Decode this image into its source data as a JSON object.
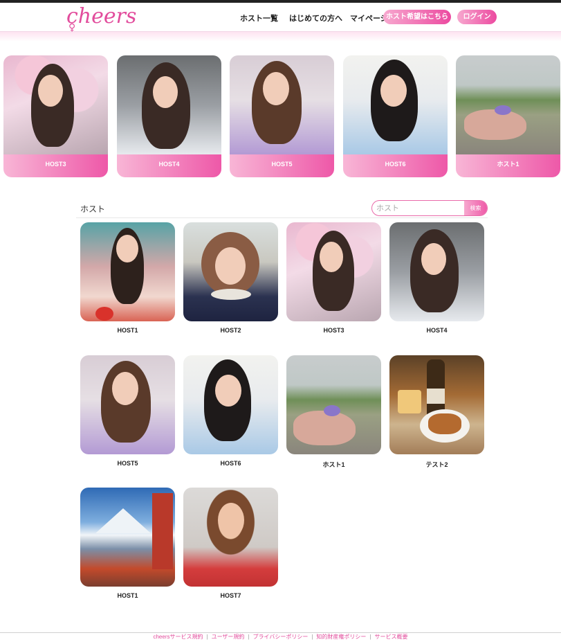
{
  "header": {
    "logo": "cheers",
    "nav": [
      "ホスト一覧",
      "はじめての方へ",
      "マイページ"
    ],
    "host_apply": "ホスト希望はこちら",
    "login": "ログイン"
  },
  "featured": [
    {
      "name": "HOST3",
      "photo": "cherry"
    },
    {
      "name": "HOST4",
      "photo": "sailor"
    },
    {
      "name": "HOST5",
      "photo": "lavender"
    },
    {
      "name": "HOST6",
      "photo": "blue"
    },
    {
      "name": "ホスト1",
      "photo": "field"
    }
  ],
  "hosts_section": {
    "title": "ホスト",
    "search_placeholder": "ホスト",
    "search_button": "検索"
  },
  "hosts": [
    {
      "name": "HOST1",
      "photo": "ao"
    },
    {
      "name": "HOST2",
      "photo": "bob"
    },
    {
      "name": "HOST3",
      "photo": "cherry"
    },
    {
      "name": "HOST4",
      "photo": "sailor"
    },
    {
      "name": "HOST5",
      "photo": "lavender"
    },
    {
      "name": "HOST6",
      "photo": "blue"
    },
    {
      "name": "ホスト1",
      "photo": "field"
    },
    {
      "name": "テスト2",
      "photo": "beer"
    },
    {
      "name": "HOST1",
      "photo": "fuji"
    },
    {
      "name": "HOST7",
      "photo": "portrait"
    }
  ],
  "footer": {
    "links": [
      "cheersサービス規約",
      "ユーザー規約",
      "プライバシーポリシー",
      "知的財産権ポリシー",
      "サービス概要"
    ]
  },
  "colors": {
    "accent": "#e24c9c",
    "gradient_start": "#f7a8cf",
    "gradient_end": "#ec4aa0"
  }
}
